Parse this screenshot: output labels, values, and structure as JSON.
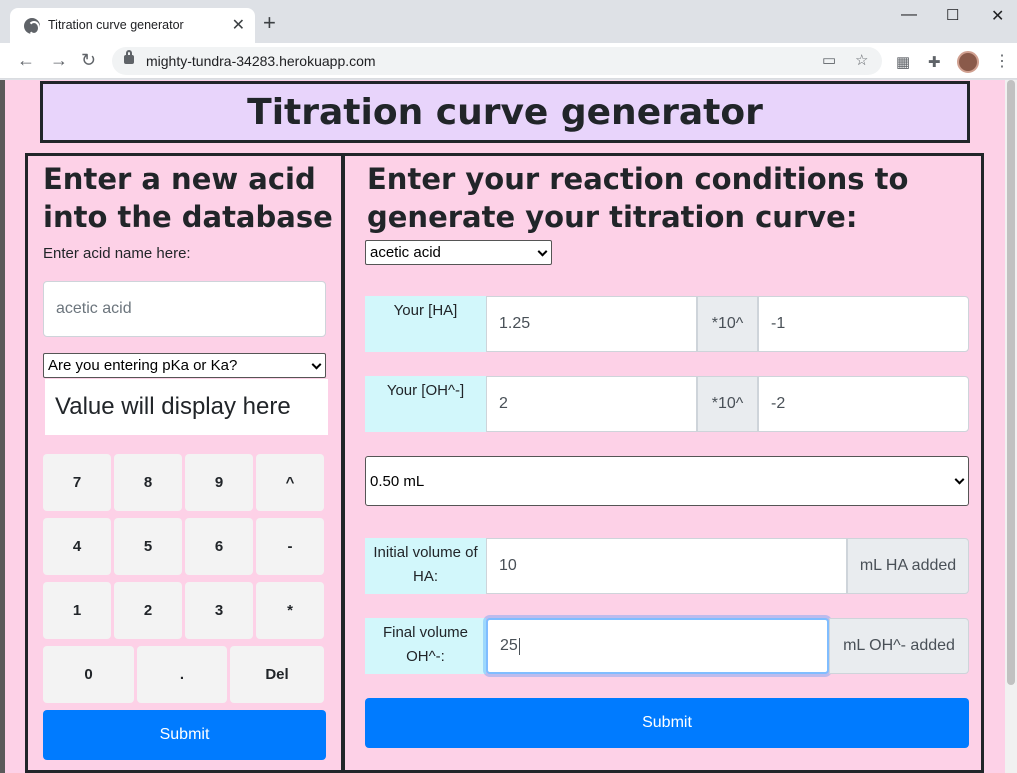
{
  "browser": {
    "tab_title": "Titration curve generator",
    "url": "mighty-tundra-34283.herokuapp.com"
  },
  "page": {
    "title": "Titration curve generator"
  },
  "left_panel": {
    "heading": "Enter a new acid into the database",
    "acid_name_label": "Enter acid name here:",
    "acid_name_placeholder": "acetic acid",
    "ka_select_value": "Are you entering pKa or Ka?",
    "value_display": "Value will display here",
    "keypad": [
      "7",
      "8",
      "9",
      "^",
      "4",
      "5",
      "6",
      "-",
      "1",
      "2",
      "3",
      "*",
      "0",
      ".",
      "Del"
    ],
    "submit_label": "Submit"
  },
  "right_panel": {
    "heading": "Enter your reaction conditions to generate your titration curve:",
    "acid_select_value": "acetic acid",
    "ha": {
      "label": "Your [HA]",
      "mantissa": "1.25",
      "times_label": "*10^",
      "exponent": "-1"
    },
    "oh": {
      "label": "Your [OH^-]",
      "mantissa": "2",
      "times_label": "*10^",
      "exponent": "-2"
    },
    "increment_select_value": "0.50 mL",
    "initial_volume": {
      "label": "Initial volume of HA:",
      "value": "10",
      "unit": "mL HA added"
    },
    "final_volume": {
      "label": "Final volume OH^-:",
      "value": "25",
      "unit": "mL OH^- added"
    },
    "submit_label": "Submit"
  }
}
